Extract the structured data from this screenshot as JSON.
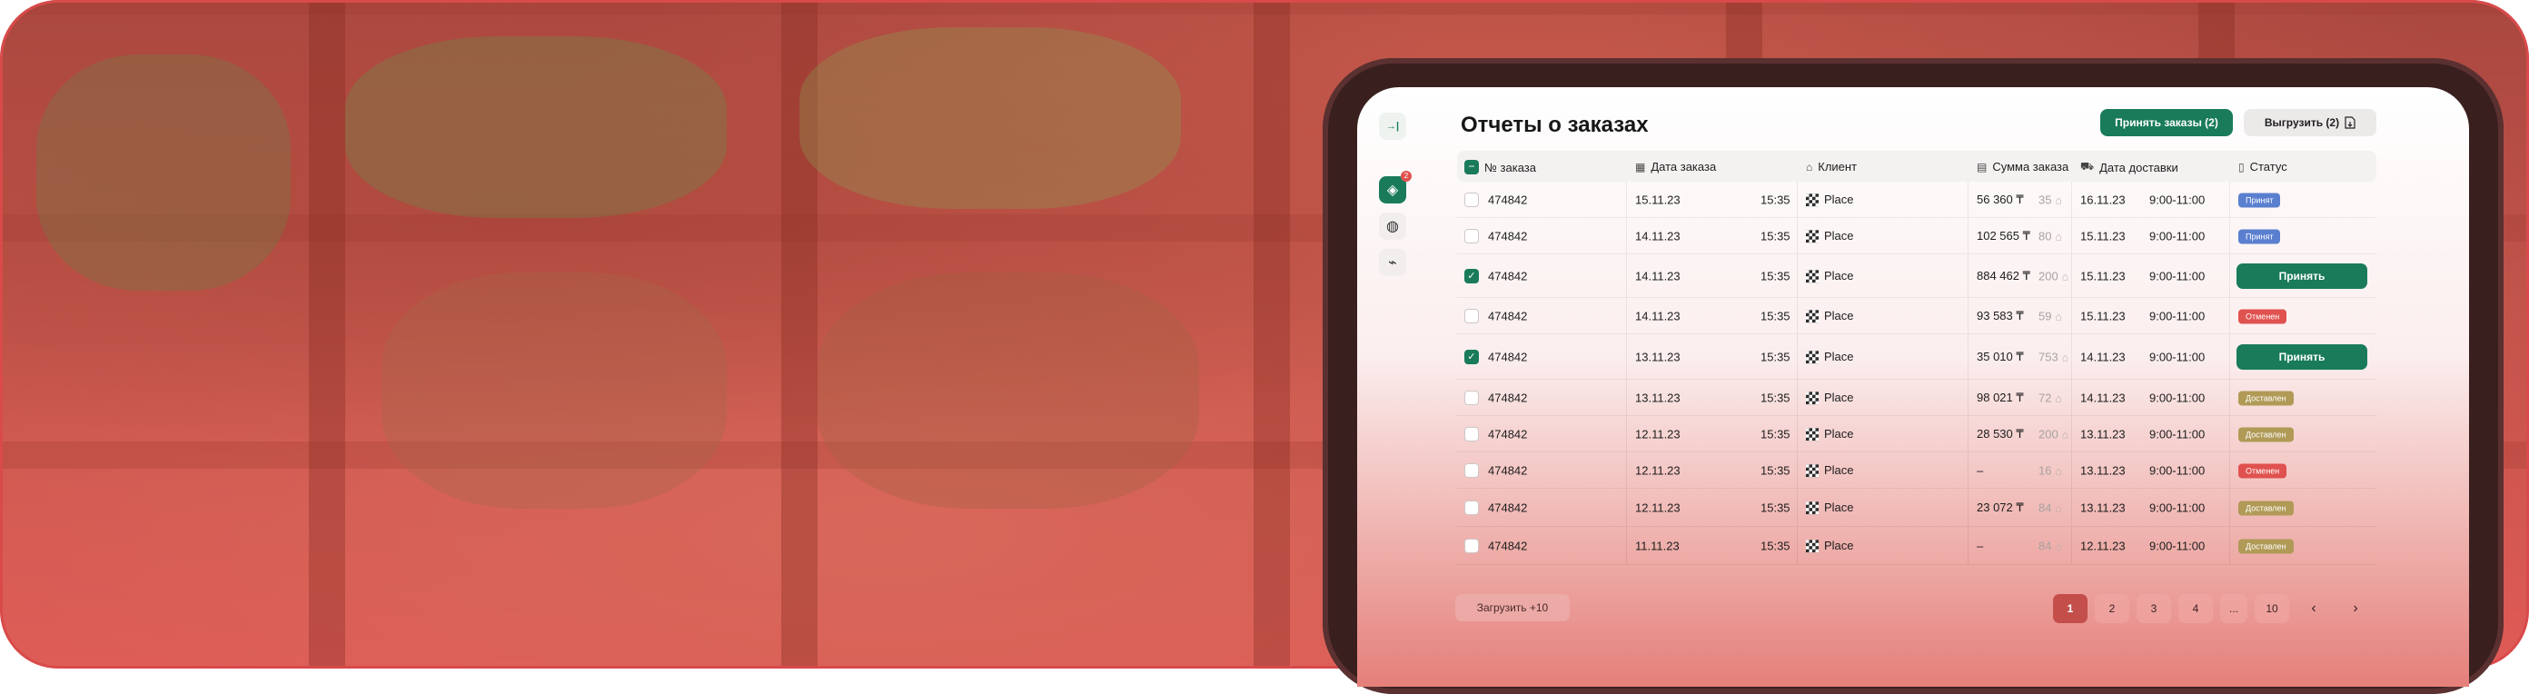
{
  "app": {
    "page_title": "Отчеты о заказах",
    "accept_orders_button": "Принять заказы (2)",
    "export_button": "Выгрузить (2)",
    "export_icon": "document-export-icon"
  },
  "sidebar": {
    "items": [
      {
        "icon": "collapse-sidebar-icon",
        "glyph": "→|"
      },
      {
        "icon": "layers-icon",
        "glyph": "◈",
        "badge": "2"
      },
      {
        "icon": "apple-icon",
        "glyph": "◍"
      },
      {
        "icon": "chart-line-icon",
        "glyph": "⌁"
      }
    ]
  },
  "table": {
    "headers": {
      "order_no": "№ заказа",
      "order_date": "Дата заказа",
      "client": "Клиент",
      "amount": "Сумма заказа",
      "delivery_date": "Дата доставки",
      "status": "Статус"
    },
    "rows": [
      {
        "id": "474842",
        "checked": false,
        "date": "15.11.23",
        "time": "15:35",
        "client": "Place",
        "sum": "56 360 ₸",
        "items": "35",
        "ddate": "16.11.23",
        "dtime": "9:00-11:00",
        "status": "Принят",
        "status_kind": "accepted",
        "action": ""
      },
      {
        "id": "474842",
        "checked": false,
        "date": "14.11.23",
        "time": "15:35",
        "client": "Place",
        "sum": "102 565 ₸",
        "items": "80",
        "ddate": "15.11.23",
        "dtime": "9:00-11:00",
        "status": "Принят",
        "status_kind": "accepted",
        "action": ""
      },
      {
        "id": "474842",
        "checked": true,
        "date": "14.11.23",
        "time": "15:35",
        "client": "Place",
        "sum": "884 462 ₸",
        "items": "200",
        "ddate": "15.11.23",
        "dtime": "9:00-11:00",
        "status": "",
        "status_kind": "",
        "action": "Принять"
      },
      {
        "id": "474842",
        "checked": false,
        "date": "14.11.23",
        "time": "15:35",
        "client": "Place",
        "sum": "93 583 ₸",
        "items": "59",
        "ddate": "15.11.23",
        "dtime": "9:00-11:00",
        "status": "Отменен",
        "status_kind": "cancelled",
        "action": ""
      },
      {
        "id": "474842",
        "checked": true,
        "date": "13.11.23",
        "time": "15:35",
        "client": "Place",
        "sum": "35 010 ₸",
        "items": "753",
        "ddate": "14.11.23",
        "dtime": "9:00-11:00",
        "status": "",
        "status_kind": "",
        "action": "Принять"
      },
      {
        "id": "474842",
        "checked": false,
        "date": "13.11.23",
        "time": "15:35",
        "client": "Place",
        "sum": "98 021 ₸",
        "items": "72",
        "ddate": "14.11.23",
        "dtime": "9:00-11:00",
        "status": "Доставлен",
        "status_kind": "delivered",
        "action": ""
      },
      {
        "id": "474842",
        "checked": false,
        "date": "12.11.23",
        "time": "15:35",
        "client": "Place",
        "sum": "28 530 ₸",
        "items": "200",
        "ddate": "13.11.23",
        "dtime": "9:00-11:00",
        "status": "Доставлен",
        "status_kind": "delivered",
        "action": ""
      },
      {
        "id": "474842",
        "checked": false,
        "date": "12.11.23",
        "time": "15:35",
        "client": "Place",
        "sum": "–",
        "items": "16",
        "ddate": "13.11.23",
        "dtime": "9:00-11:00",
        "status": "Отменен",
        "status_kind": "cancelled",
        "action": ""
      },
      {
        "id": "474842",
        "checked": false,
        "date": "12.11.23",
        "time": "15:35",
        "client": "Place",
        "sum": "23 072 ₸",
        "items": "84",
        "ddate": "13.11.23",
        "dtime": "9:00-11:00",
        "status": "Доставлен",
        "status_kind": "delivered",
        "action": ""
      },
      {
        "id": "474842",
        "checked": false,
        "date": "11.11.23",
        "time": "15:35",
        "client": "Place",
        "sum": "–",
        "items": "84",
        "ddate": "12.11.23",
        "dtime": "9:00-11:00",
        "status": "Доставлен",
        "status_kind": "delivered",
        "action": ""
      }
    ]
  },
  "footer": {
    "load_more": "Загрузить +10",
    "pages": [
      "1",
      "2",
      "3",
      "4",
      "...",
      "10"
    ],
    "prev": "‹",
    "next": "›"
  },
  "colors": {
    "brand_green": "#197b5a",
    "accepted": "#5a7fcf",
    "cancelled": "#e0524f",
    "delivered": "#b09a56",
    "banner_red": "#e05a56"
  }
}
